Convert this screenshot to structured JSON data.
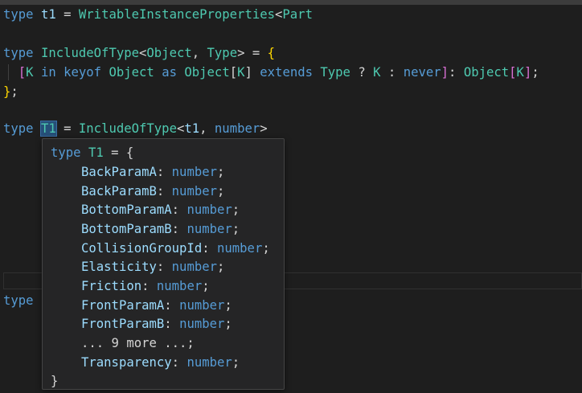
{
  "editor": {
    "line1": {
      "kw": "type",
      "name": "t1",
      "eq": "=",
      "type_name": "WritableInstanceProperties",
      "lt": "<",
      "arg": "Part"
    },
    "line2": {
      "kw": "type",
      "name": "IncludeOfType",
      "lt": "<",
      "p1": "Object",
      "comma": ",",
      "p2": "Type",
      "gt": ">",
      "eq": "=",
      "open_brace": "{"
    },
    "line3": {
      "open_bracket": "[",
      "k1": "K",
      "in": "in",
      "keyof": "keyof",
      "object1": "Object",
      "as": "as",
      "object2": "Object",
      "open2": "[",
      "k2": "K",
      "close2": "]",
      "extends": "extends",
      "type": "Type",
      "q": "?",
      "k3": "K",
      "colon": ":",
      "never": "never",
      "close_bracket": "]",
      "colon2": ":",
      "object3": "Object",
      "open3": "[",
      "k4": "K",
      "close3": "]",
      "semi": ";"
    },
    "line4": {
      "close_brace": "}",
      "semi": ";"
    },
    "line5": {
      "kw": "type",
      "name": "T1",
      "eq": "=",
      "type_name": "IncludeOfType",
      "lt": "<",
      "arg1": "t1",
      "comma": ",",
      "arg2": "number",
      "gt": ">"
    },
    "line6": {
      "kw": "type"
    }
  },
  "hover": {
    "header": {
      "kw": "type",
      "name": "T1",
      "eq": "=",
      "open": "{"
    },
    "members": [
      {
        "name": "BackParamA",
        "type": "number"
      },
      {
        "name": "BackParamB",
        "type": "number"
      },
      {
        "name": "BottomParamA",
        "type": "number"
      },
      {
        "name": "BottomParamB",
        "type": "number"
      },
      {
        "name": "CollisionGroupId",
        "type": "number"
      },
      {
        "name": "Elasticity",
        "type": "number"
      },
      {
        "name": "Friction",
        "type": "number"
      },
      {
        "name": "FrontParamA",
        "type": "number"
      },
      {
        "name": "FrontParamB",
        "type": "number"
      }
    ],
    "more": "... 9 more ...;",
    "last": {
      "name": "Transparency",
      "type": "number"
    },
    "close": "}"
  },
  "colors": {
    "background": "#1e1e1e",
    "keyword": "#569cd6",
    "type": "#4ec9b0",
    "variable": "#9cdcfe",
    "brace": "#ffd700",
    "bracket": "#da70d6",
    "hover_bg": "#252526",
    "hover_border": "#454545"
  }
}
